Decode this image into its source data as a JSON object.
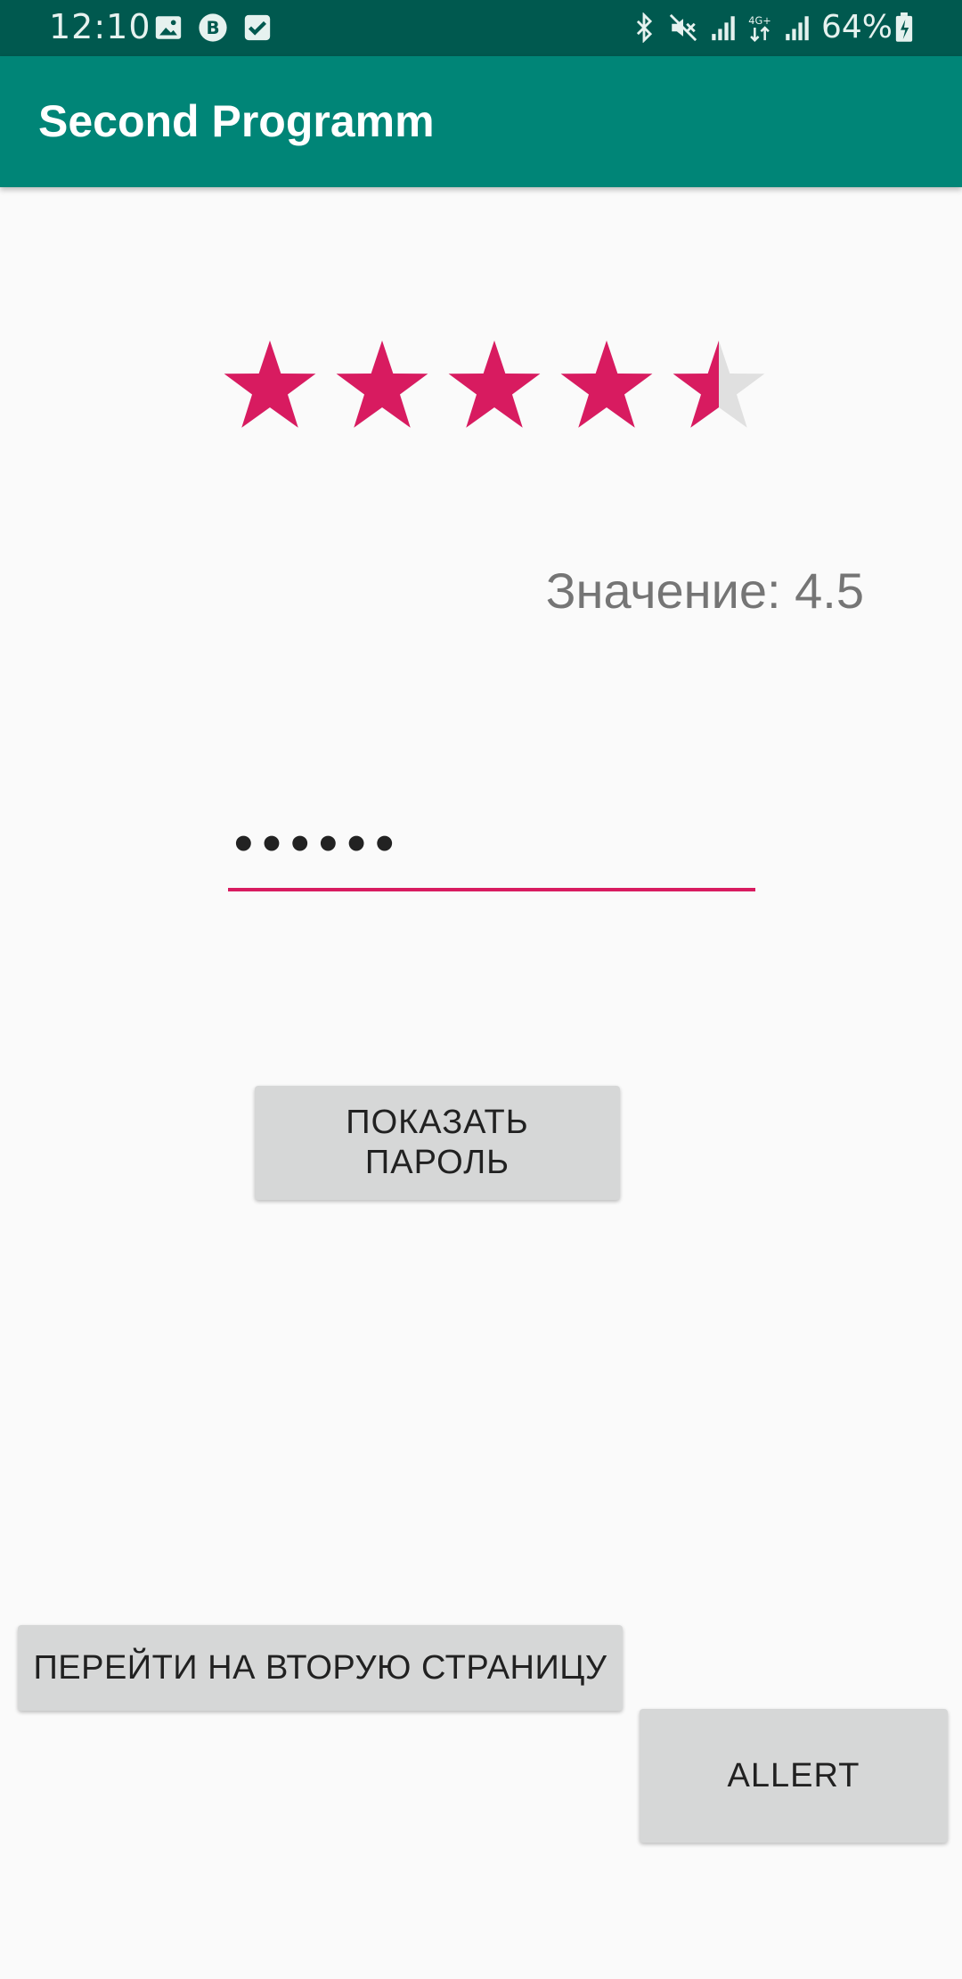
{
  "status_bar": {
    "time": "12:10",
    "battery_percent": "64%",
    "network_label": "4G+",
    "icons": [
      "image-icon",
      "vk-icon",
      "check-icon",
      "bluetooth-icon",
      "mute-icon",
      "signal-icon",
      "signal-4g-icon",
      "signal-icon-2",
      "battery-charging-icon"
    ]
  },
  "app_bar": {
    "title": "Second Programm"
  },
  "rating": {
    "value": 4.5,
    "max": 5,
    "filled_color": "#d81b60",
    "empty_color": "#e0e0e0"
  },
  "value_text": "Значение: 4.5",
  "password_field": {
    "value": "••••••",
    "underline_color": "#d81b60"
  },
  "buttons": {
    "show_password": "ПОКАЗАТЬ\nПАРОЛЬ",
    "next_page": "ПЕРЕЙТИ НА ВТОРУЮ СТРАНИЦУ",
    "alert": "ALLERT"
  },
  "colors": {
    "status_bar": "#00594f",
    "app_bar": "#008577",
    "background": "#fafafa",
    "button": "#d6d7d7",
    "accent": "#d81b60"
  }
}
